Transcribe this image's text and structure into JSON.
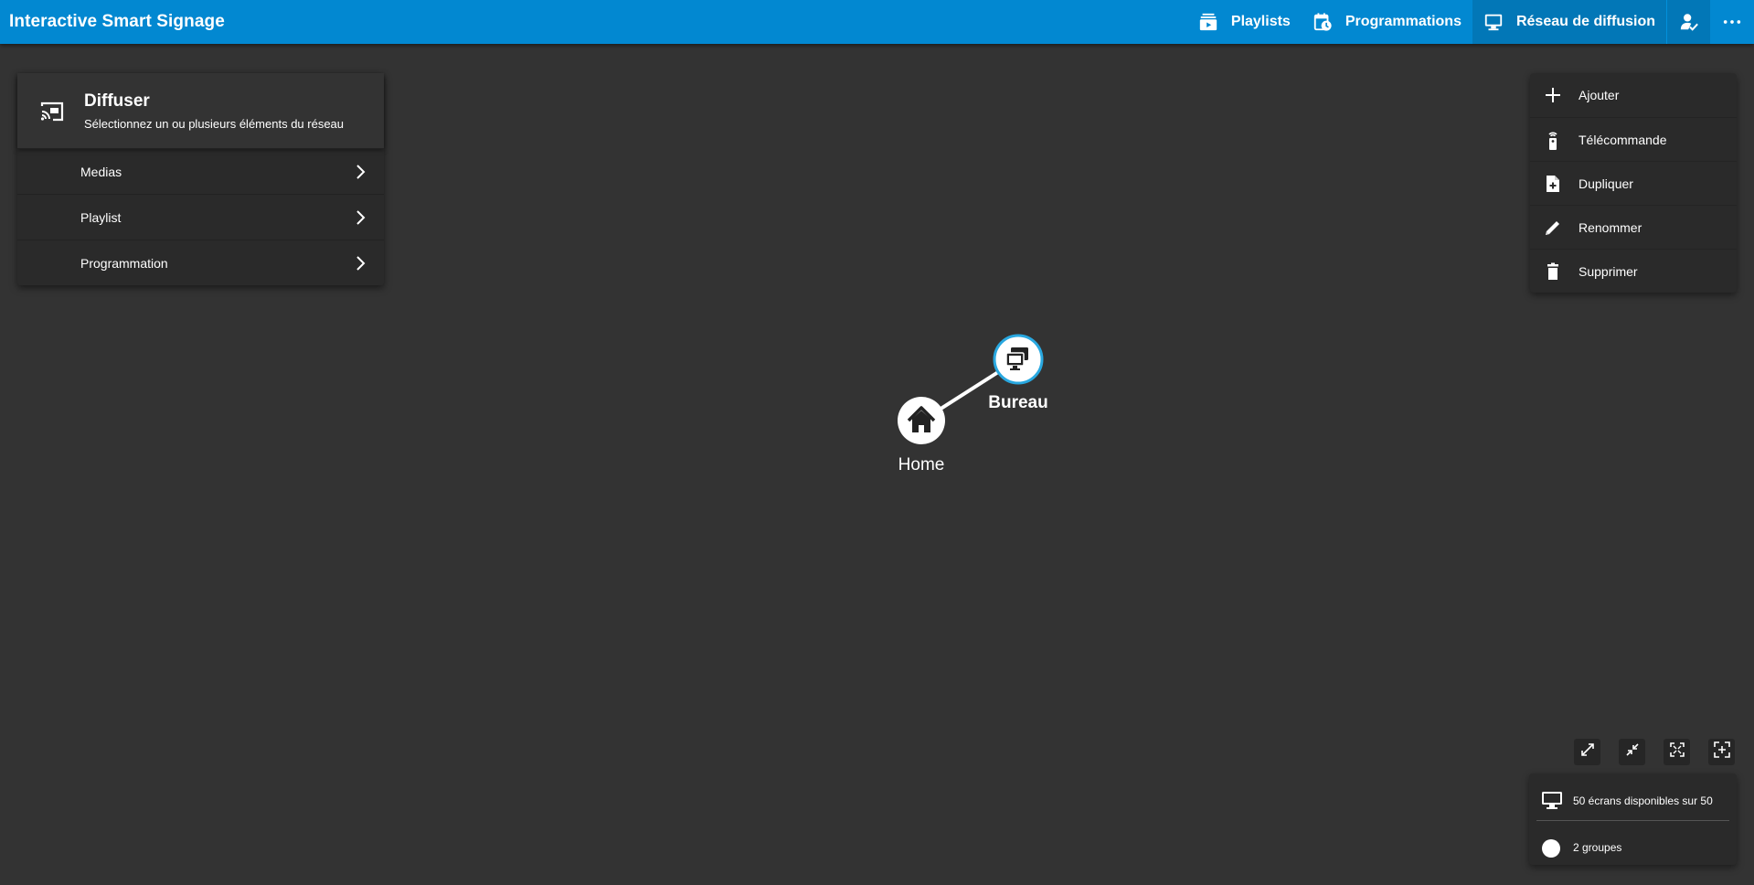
{
  "app": {
    "title": "Interactive Smart Signage"
  },
  "nav": {
    "items": [
      {
        "label": "Playlists",
        "icon": "playlist-play-icon"
      },
      {
        "label": "Programmations",
        "icon": "calendar-clock-icon"
      },
      {
        "label": "Réseau de diffusion",
        "icon": "monitor-icon",
        "active": true
      }
    ],
    "user_icon": "user-check-icon",
    "more_icon": "more-dots-icon"
  },
  "diffuser": {
    "title": "Diffuser",
    "subtitle": "Sélectionnez un ou plusieurs éléments du réseau",
    "items": [
      {
        "label": "Medias"
      },
      {
        "label": "Playlist"
      },
      {
        "label": "Programmation"
      }
    ]
  },
  "actions": {
    "items": [
      {
        "label": "Ajouter",
        "icon": "plus-icon"
      },
      {
        "label": "Télécommande",
        "icon": "remote-icon"
      },
      {
        "label": "Dupliquer",
        "icon": "file-duplicate-icon"
      },
      {
        "label": "Renommer",
        "icon": "pencil-icon"
      },
      {
        "label": "Supprimer",
        "icon": "trash-icon"
      }
    ]
  },
  "graph": {
    "nodes": [
      {
        "label": "Home",
        "icon": "home-icon"
      },
      {
        "label": "Bureau",
        "icon": "screen-group-icon",
        "selected": true
      }
    ]
  },
  "status": {
    "screens": "50 écrans disponibles sur 50",
    "groups": "2 groupes"
  },
  "colors": {
    "topbar": "#0288d1",
    "topbar_active": "#0277b7",
    "canvas": "#333333",
    "panel": "#2a2a2a",
    "selected_ring": "#29a8e0"
  }
}
